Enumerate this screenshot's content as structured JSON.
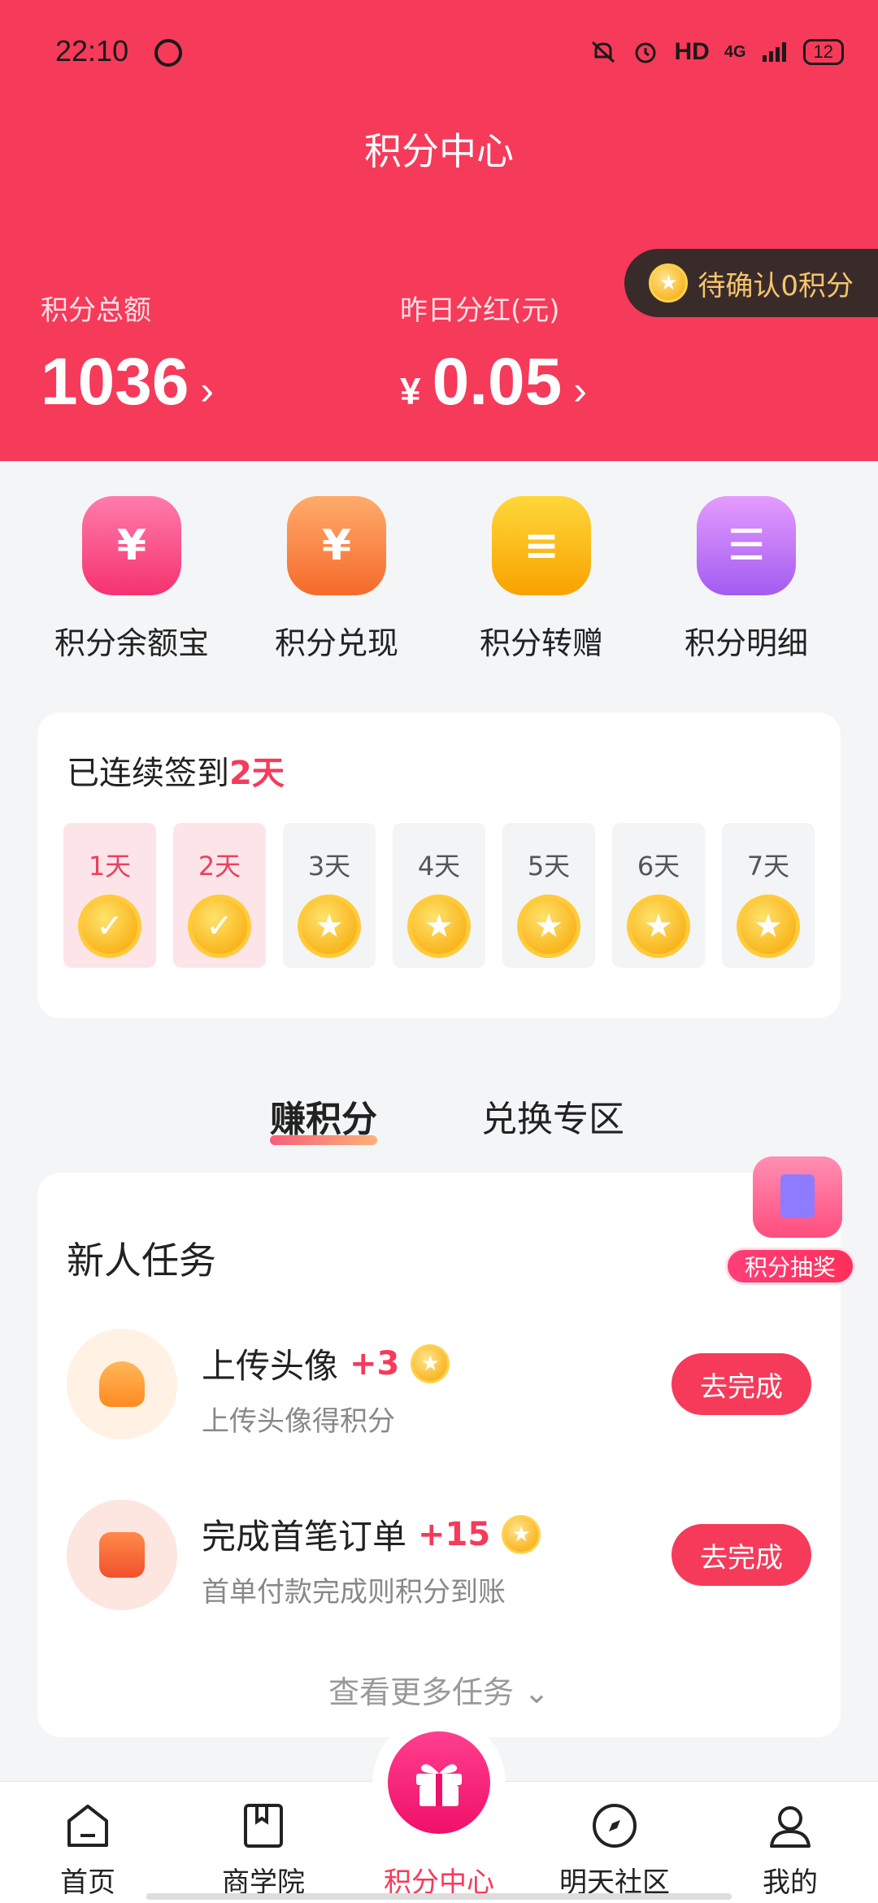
{
  "status_bar": {
    "time": "22:10",
    "network": "HD",
    "signal": "4G",
    "battery": "12"
  },
  "header": {
    "title": "积分中心",
    "pending": {
      "label": "待确认0积分"
    },
    "total_points": {
      "label": "积分总额",
      "value": "1036"
    },
    "dividend": {
      "label": "昨日分红(元)",
      "currency": "¥",
      "value": "0.05"
    }
  },
  "quick_actions": [
    {
      "label": "积分余额宝",
      "icon": "money-bag-icon",
      "glyph": "¥"
    },
    {
      "label": "积分兑现",
      "icon": "cash-out-icon",
      "glyph": "¥"
    },
    {
      "label": "积分转赠",
      "icon": "coin-stack-icon",
      "glyph": "≡"
    },
    {
      "label": "积分明细",
      "icon": "detail-list-icon",
      "glyph": "☰"
    }
  ],
  "checkin": {
    "prefix": "已连续签到",
    "days_count": "2天",
    "days": [
      {
        "label": "1天",
        "status": "done"
      },
      {
        "label": "2天",
        "status": "done"
      },
      {
        "label": "3天",
        "status": "pending"
      },
      {
        "label": "4天",
        "status": "pending"
      },
      {
        "label": "5天",
        "status": "pending"
      },
      {
        "label": "6天",
        "status": "pending"
      },
      {
        "label": "7天",
        "status": "pending"
      }
    ]
  },
  "tabs": {
    "earn": "赚积分",
    "exchange": "兑换专区"
  },
  "tasks": {
    "title": "新人任务",
    "items": [
      {
        "name": "上传头像",
        "points": "+3",
        "desc": "上传头像得积分",
        "button": "去完成"
      },
      {
        "name": "完成首笔订单",
        "points": "+15",
        "desc": "首单付款完成则积分到账",
        "button": "去完成"
      }
    ],
    "more": "查看更多任务"
  },
  "lottery": {
    "label": "积分抽奖"
  },
  "bottom_nav": {
    "items": [
      {
        "label": "首页",
        "icon": "home-icon"
      },
      {
        "label": "商学院",
        "icon": "book-icon"
      },
      {
        "label": "积分中心",
        "icon": "gift-icon",
        "active": true
      },
      {
        "label": "明天社区",
        "icon": "compass-icon"
      },
      {
        "label": "我的",
        "icon": "profile-icon"
      }
    ]
  },
  "colors": {
    "primary": "#f63a5a",
    "gold": "#f7a300",
    "background": "#f4f5f7"
  }
}
